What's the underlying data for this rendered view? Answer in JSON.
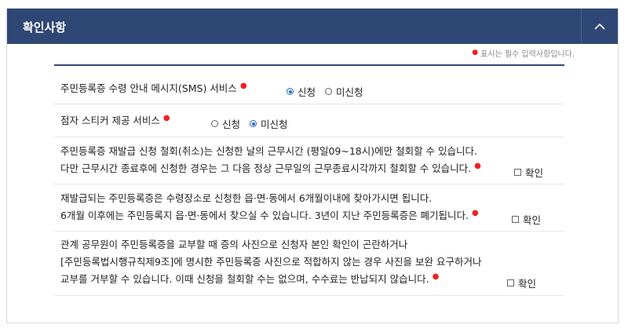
{
  "header": {
    "title": "확인사항"
  },
  "required_note": "표시는 필수 입력사항입니다.",
  "sms_service": {
    "label": "주민등록증 수령 안내 메시지(SMS) 서비스",
    "options": [
      "신청",
      "미신청"
    ],
    "selected": "신청"
  },
  "braille_service": {
    "label": "점자 스티커 제공 서비스",
    "options": [
      "신청",
      "미신청"
    ],
    "selected": "미신청"
  },
  "confirm1": {
    "line1": "주민등록증 재발급 신청 철회(취소)는 신청한 날의 근무시간 (평일09~18시)에만 철회할 수 있습니다.",
    "line2": "다만 근무시간 종료후에 신청한 경우는 그 다음 정상 근무일의 근무종료시각까지 철회할 수 있습니다.",
    "check_label": "확인"
  },
  "confirm2": {
    "line1": "재발급되는 주민등록증은 수령장소로 신청한 읍·면·동에서 6개월이내에 찾아가시면 됩니다.",
    "line2": "6개월 이후에는 주민등록지 읍·면·동에서 찾으실 수 있습니다. 3년이 지난 주민등록증은 폐기됩니다.",
    "check_label": "확인"
  },
  "confirm3": {
    "line1": "관계 공무원이 주민등록증을 교부할 때 증의 사진으로 신청자 본인 확인이 곤란하거나",
    "line2": "[주민등록법시행규칙제9조]에 명시한 주민등록증 사진으로 적합하지 않는 경우 사진을 보완 요구하거나",
    "line3": "교부를 거부할 수 있습니다. 이때 신청을 철회할 수는 없으며, 수수료는 반납되지 않습니다.",
    "check_label": "확인"
  },
  "colors": {
    "header_bg": "#2f4775",
    "required": "#e22222",
    "radio_selected": "#2468c6"
  },
  "icons": {
    "collapse": "chevron-up-icon"
  }
}
